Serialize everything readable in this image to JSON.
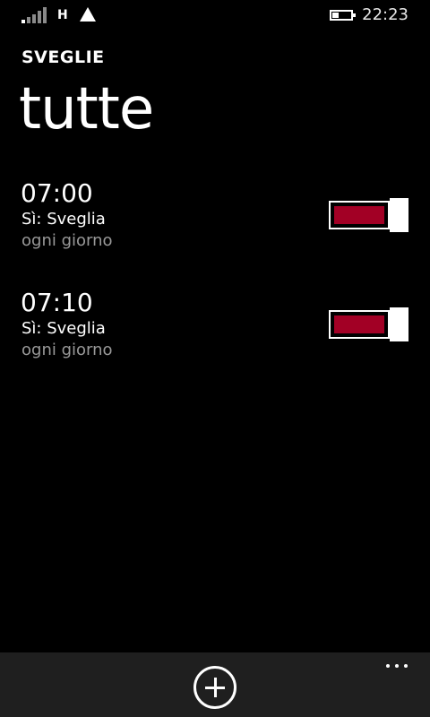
{
  "status_bar": {
    "network_type": "H",
    "time": "22:23",
    "signal_bars_active": 1,
    "signal_icon": "signal-strength-icon",
    "data_icon": "triangle-icon",
    "battery_icon": "battery-icon",
    "battery_level": 0.4
  },
  "header": {
    "app_title": "SVEGLIE",
    "pivot_title": "tutte"
  },
  "alarms": [
    {
      "time": "07:00",
      "label": "Sì:  Sveglia",
      "recurrence": "ogni giorno",
      "enabled": true
    },
    {
      "time": "07:10",
      "label": "Sì:  Sveglia",
      "recurrence": "ogni giorno",
      "enabled": true
    }
  ],
  "app_bar": {
    "add_icon": "add-circle-icon",
    "more_icon": "ellipsis-icon"
  },
  "colors": {
    "accent": "#a20025",
    "background": "#000000",
    "app_bar_background": "#1f1f1f",
    "foreground": "#ffffff",
    "secondary_text": "#999999"
  }
}
